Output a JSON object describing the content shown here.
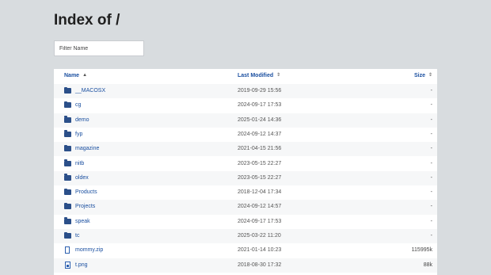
{
  "page": {
    "title": "Index of /",
    "filter_placeholder": "Filter Name"
  },
  "table": {
    "headers": {
      "name": "Name",
      "modified": "Last Modified",
      "size": "Size"
    },
    "rows": [
      {
        "name": "__MACOSX",
        "type": "folder",
        "modified": "2019-09-29 15:56",
        "size": "-"
      },
      {
        "name": "cg",
        "type": "folder",
        "modified": "2024-09-17 17:53",
        "size": "-"
      },
      {
        "name": "demo",
        "type": "folder",
        "modified": "2025-01-24 14:36",
        "size": "-"
      },
      {
        "name": "fyp",
        "type": "folder",
        "modified": "2024-09-12 14:37",
        "size": "-"
      },
      {
        "name": "magazine",
        "type": "folder",
        "modified": "2021-04-15 21:56",
        "size": "-"
      },
      {
        "name": "nitb",
        "type": "folder",
        "modified": "2023-05-15 22:27",
        "size": "-"
      },
      {
        "name": "oldex",
        "type": "folder",
        "modified": "2023-05-15 22:27",
        "size": "-"
      },
      {
        "name": "Products",
        "type": "folder",
        "modified": "2018-12-04 17:34",
        "size": "-"
      },
      {
        "name": "Projects",
        "type": "folder",
        "modified": "2024-09-12 14:57",
        "size": "-"
      },
      {
        "name": "speak",
        "type": "folder",
        "modified": "2024-09-17 17:53",
        "size": "-"
      },
      {
        "name": "tc",
        "type": "folder",
        "modified": "2025-03-22 11:20",
        "size": "-"
      },
      {
        "name": "mommy.zip",
        "type": "file",
        "modified": "2021-01-14 10:23",
        "size": "115995k"
      },
      {
        "name": "t.png",
        "type": "image",
        "modified": "2018-08-30 17:32",
        "size": "88k"
      }
    ]
  },
  "icons": {
    "folder": "folder-icon",
    "file": "file-icon",
    "image": "image-file-icon",
    "sort": "sort-arrows-icon"
  },
  "colors": {
    "background": "#d8dcdf",
    "link": "#1a4fa0",
    "folder_icon": "#2b4f89"
  }
}
